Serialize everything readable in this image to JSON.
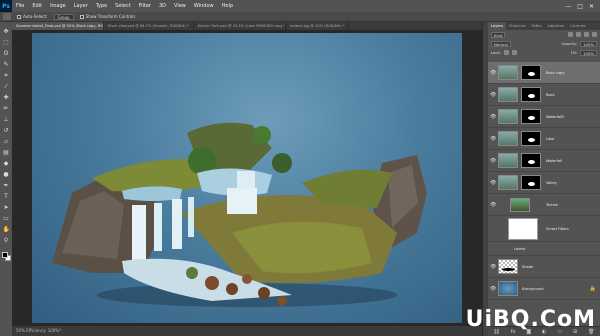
{
  "app": {
    "logo": "Ps"
  },
  "menubar": {
    "items": [
      "File",
      "Edit",
      "Image",
      "Layer",
      "Type",
      "Select",
      "Filter",
      "3D",
      "View",
      "Window",
      "Help"
    ],
    "window_controls": [
      "—",
      "□",
      "✕"
    ]
  },
  "options": {
    "auto_select_label": "Auto-Select:",
    "auto_select_value": "Group",
    "show_transform_label": "Show Transform Controls"
  },
  "doc_tabs": [
    {
      "label": "Summer Island_Final.psd @ 50% (Rock copy, RGB/8#) *",
      "active": true
    },
    {
      "label": "River view.psd @ 66.7% (Smooth, RGB/8#) *",
      "active": false
    },
    {
      "label": "Glacier Park.psd @ 33.3% (Lake FINISHED copy 3, RGB/8#) *",
      "active": false
    },
    {
      "label": "Iceland.jpg @ 25% (RGB/8#) *",
      "active": false
    }
  ],
  "status": {
    "text": "50%   Efficiency: 100%*"
  },
  "panel": {
    "tabs": [
      "Layers",
      "Channels",
      "Paths",
      "Adjustme",
      "Libraries"
    ],
    "kind_label": "Kind",
    "blend_mode": "Normal",
    "opacity_label": "Opacity:",
    "opacity_value": "100%",
    "lock_label": "Lock:",
    "fill_label": "Fill:",
    "fill_value": "100%",
    "layers": [
      {
        "name": "Rock copy",
        "selected": true,
        "italic": false
      },
      {
        "name": "Rock",
        "selected": false,
        "italic": false
      },
      {
        "name": "Waterfall2",
        "selected": false,
        "italic": false
      },
      {
        "name": "Lake",
        "selected": false,
        "italic": false
      },
      {
        "name": "Waterfall",
        "selected": false,
        "italic": false
      },
      {
        "name": "Valley",
        "selected": false,
        "italic": false
      }
    ],
    "terrain": {
      "name": "Terrain",
      "smart_filters": "Smart Filters",
      "levels": "Levels"
    },
    "shadow": {
      "name": "Shade"
    },
    "background": {
      "name": "Background"
    },
    "footer_icons": [
      "link-icon",
      "fx-icon",
      "mask-icon",
      "adjustment-icon",
      "folder-icon",
      "new-layer-icon",
      "trash-icon"
    ]
  },
  "watermark": "UiBQ.CoM"
}
